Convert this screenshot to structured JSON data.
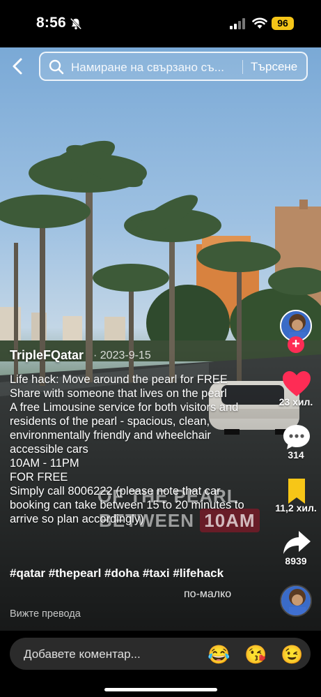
{
  "status": {
    "time": "8:56",
    "battery": "96"
  },
  "search": {
    "placeholder": "Намиране на свързано съ...",
    "button_label": "Търсене"
  },
  "video_overlay": {
    "line1": "OF THE PEARL",
    "line2_a": "BETWEEN",
    "line2_b": "10AM"
  },
  "post": {
    "author": "TripleFQatar",
    "date": "· 2023-9-15",
    "caption_lines": [
      "Life hack: Move around the pearl for FREE",
      "Share with someone that lives on the pearl",
      "A free Limousine service for both visitors and residents of the pearl - spacious, clean, environmentally friendly and wheelchair accessible cars",
      "10AM - 11PM",
      "FOR FREE",
      "Simply call 8006222 (please note that car booking can take between 15 to 20 minutes to arrive so plan accordingly)"
    ],
    "hashtags": "#qatar #thepearl #doha #taxi #lifehack",
    "less_label": "по-малко",
    "translate_label": "Вижте превода"
  },
  "rail": {
    "likes": "23 хил.",
    "comments": "314",
    "saves": "11,2 хил.",
    "shares": "8939",
    "follow_symbol": "+"
  },
  "comment": {
    "placeholder": "Добавете коментар...",
    "emojis": [
      "😂",
      "😘",
      "😉"
    ]
  },
  "colors": {
    "accent_red": "#fe2c55",
    "save_yellow": "#f7c617",
    "battery_yellow": "#f5c518"
  }
}
